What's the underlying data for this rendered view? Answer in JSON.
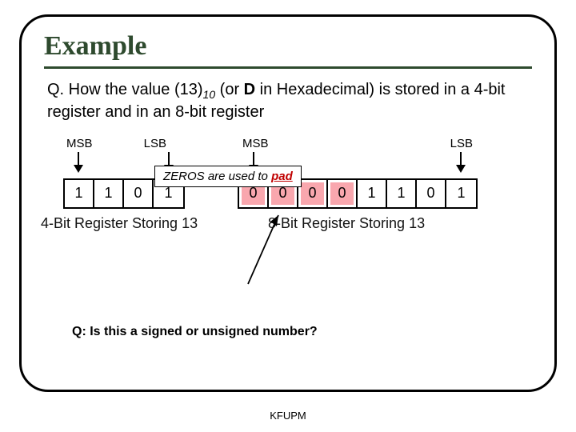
{
  "title": "Example",
  "question_prefix": "Q. How the value (13)",
  "question_sub": "10",
  "question_mid": " (or ",
  "question_bold": "D",
  "question_tail": " in Hexadecimal) is stored in a 4-bit register and in an 8-bit register",
  "labels": {
    "msb": "MSB",
    "lsb": "LSB"
  },
  "reg4_bits": [
    "1",
    "1",
    "0",
    "1"
  ],
  "reg8_bits": [
    "0",
    "0",
    "0",
    "0",
    "1",
    "1",
    "0",
    "1"
  ],
  "reg8_pad_count": 4,
  "caption4": "4-Bit Register Storing 13",
  "caption8": "8-Bit Register Storing 13",
  "pad_callout_pre": "ZEROS are used to ",
  "pad_callout_word": "pad",
  "question2": "Q: Is this a signed or unsigned number?",
  "footer": "KFUPM"
}
